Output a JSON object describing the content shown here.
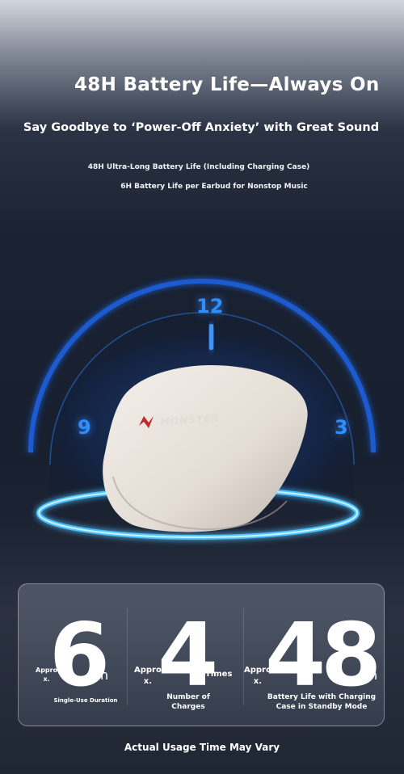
{
  "hero": {
    "title": "48H Battery Life—Always On",
    "subtitle": "Say Goodbye to ‘Power-Off Anxiety’ with Great Sound"
  },
  "features": [
    "48H Ultra-Long Battery Life (Including Charging Case)",
    "6H Battery Life per Earbud for Nonstop Music"
  ],
  "clock": {
    "num_12": "12",
    "num_9": "9",
    "num_3": "3"
  },
  "product": {
    "brand": "MONSTER"
  },
  "stats": [
    {
      "approx": "Appro\nx.",
      "value": "6",
      "unit": "h",
      "caption": "Single-Use Duration"
    },
    {
      "approx": "Appro\nx.",
      "value": "4",
      "unit": "Times",
      "caption": "Number of\nCharges"
    },
    {
      "approx": "Appro\nx.",
      "value": "48",
      "unit": "h",
      "caption": "Battery Life with Charging\nCase in Standby Mode"
    }
  ],
  "footer_note": "Actual Usage Time May Vary",
  "colors": {
    "accent_blue": "#2f8fff",
    "background": "#1a2130"
  }
}
